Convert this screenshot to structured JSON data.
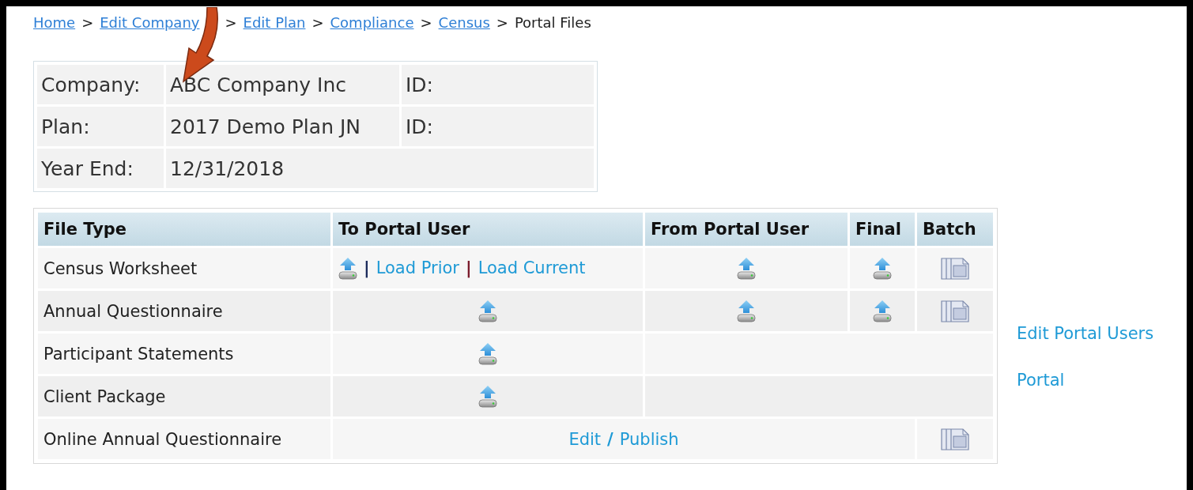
{
  "breadcrumb": {
    "separator": ">",
    "items": [
      {
        "label": "Home",
        "link": true
      },
      {
        "label": "Edit Company",
        "link": true
      },
      {
        "label": "Edit Plan",
        "link": true
      },
      {
        "label": "Compliance",
        "link": true
      },
      {
        "label": "Census",
        "link": true
      },
      {
        "label": "Portal Files",
        "link": false
      }
    ]
  },
  "info": {
    "rows": [
      {
        "label": "Company:",
        "value": "ABC Company Inc",
        "id_label": "ID:"
      },
      {
        "label": "Plan:",
        "value": "2017 Demo Plan JN",
        "id_label": "ID:"
      },
      {
        "label": "Year End:",
        "value": "12/31/2018"
      }
    ]
  },
  "file_table": {
    "columns": [
      "File Type",
      "To Portal User",
      "From Portal User",
      "Final",
      "Batch"
    ],
    "rows": [
      {
        "cells": [
          {
            "kind": "text",
            "text": "Census Worksheet"
          },
          {
            "kind": "links",
            "items": [
              {
                "kind": "upload"
              },
              {
                "kind": "sep",
                "text": "|",
                "color": "#1a2a5a"
              },
              {
                "kind": "link",
                "text": "Load Prior"
              },
              {
                "kind": "sep",
                "text": "|",
                "color": "#7a1a2a"
              },
              {
                "kind": "link",
                "text": "Load Current"
              }
            ]
          },
          {
            "kind": "upload"
          },
          {
            "kind": "upload"
          },
          {
            "kind": "batch"
          }
        ]
      },
      {
        "cells": [
          {
            "kind": "text",
            "text": "Annual Questionnaire"
          },
          {
            "kind": "upload"
          },
          {
            "kind": "upload"
          },
          {
            "kind": "upload"
          },
          {
            "kind": "batch"
          }
        ]
      },
      {
        "cells": [
          {
            "kind": "text",
            "text": "Participant Statements"
          },
          {
            "kind": "upload"
          },
          {
            "kind": "empty",
            "colspan": 3
          }
        ]
      },
      {
        "cells": [
          {
            "kind": "text",
            "text": "Client Package"
          },
          {
            "kind": "upload"
          },
          {
            "kind": "empty",
            "colspan": 3
          }
        ]
      },
      {
        "cells": [
          {
            "kind": "text",
            "text": "Online Annual Questionnaire"
          },
          {
            "kind": "links",
            "colspan": 3,
            "items": [
              {
                "kind": "link",
                "text": "Edit"
              },
              {
                "kind": "sep",
                "text": "/",
                "color": "#1e9ad6"
              },
              {
                "kind": "link",
                "text": "Publish"
              }
            ]
          },
          {
            "kind": "batch"
          }
        ]
      }
    ]
  },
  "side_links": [
    "Edit Portal Users",
    "Portal"
  ],
  "annotations": [
    {
      "kind": "curved-arrow"
    }
  ]
}
